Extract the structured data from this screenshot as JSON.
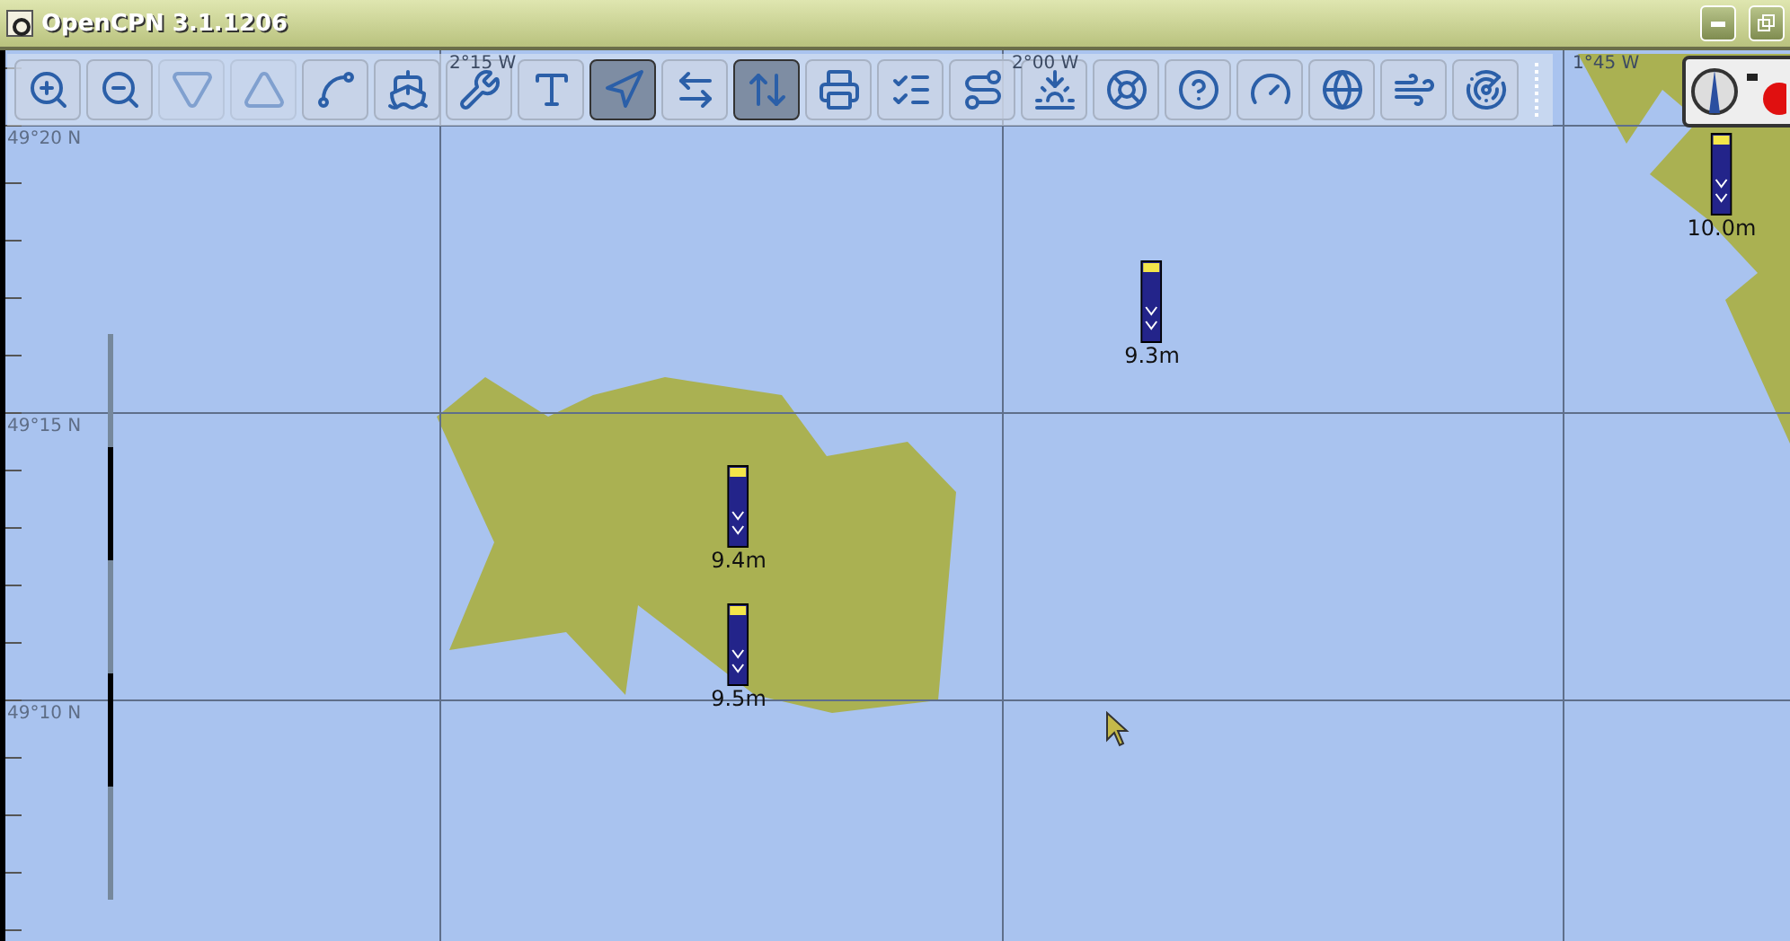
{
  "window": {
    "title": "OpenCPN 3.1.1206"
  },
  "toolbar": [
    {
      "kind": "zoom-in",
      "selected": false,
      "disabled": false
    },
    {
      "kind": "zoom-out",
      "selected": false,
      "disabled": false
    },
    {
      "kind": "scale-down",
      "selected": false,
      "disabled": true
    },
    {
      "kind": "scale-up",
      "selected": false,
      "disabled": true
    },
    {
      "kind": "route",
      "selected": false,
      "disabled": false
    },
    {
      "kind": "ship",
      "selected": false,
      "disabled": false
    },
    {
      "kind": "wrench",
      "selected": false,
      "disabled": false
    },
    {
      "kind": "text",
      "selected": false,
      "disabled": false
    },
    {
      "kind": "ais",
      "selected": true,
      "disabled": false
    },
    {
      "kind": "tides",
      "selected": false,
      "disabled": false
    },
    {
      "kind": "currents",
      "selected": true,
      "disabled": false
    },
    {
      "kind": "print",
      "selected": false,
      "disabled": false
    },
    {
      "kind": "route-manager",
      "selected": false,
      "disabled": false
    },
    {
      "kind": "track",
      "selected": false,
      "disabled": false
    },
    {
      "kind": "sunset",
      "selected": false,
      "disabled": false
    },
    {
      "kind": "lifebuoy",
      "selected": false,
      "disabled": false
    },
    {
      "kind": "help",
      "selected": false,
      "disabled": false
    },
    {
      "kind": "dashboard",
      "selected": false,
      "disabled": false
    },
    {
      "kind": "globe",
      "selected": false,
      "disabled": false
    },
    {
      "kind": "weather",
      "selected": false,
      "disabled": false
    },
    {
      "kind": "radar",
      "selected": false,
      "disabled": false
    }
  ],
  "chart": {
    "longitudes": [
      "2°15 W",
      "2°00 W",
      "1°45 W"
    ],
    "latitudes": [
      "49°20 N",
      "49°15 N",
      "49°10 N"
    ],
    "tide_stations": [
      {
        "reading": "9.3m"
      },
      {
        "reading": "9.4m"
      },
      {
        "reading": "9.5m"
      },
      {
        "reading": "10.0m"
      }
    ]
  }
}
